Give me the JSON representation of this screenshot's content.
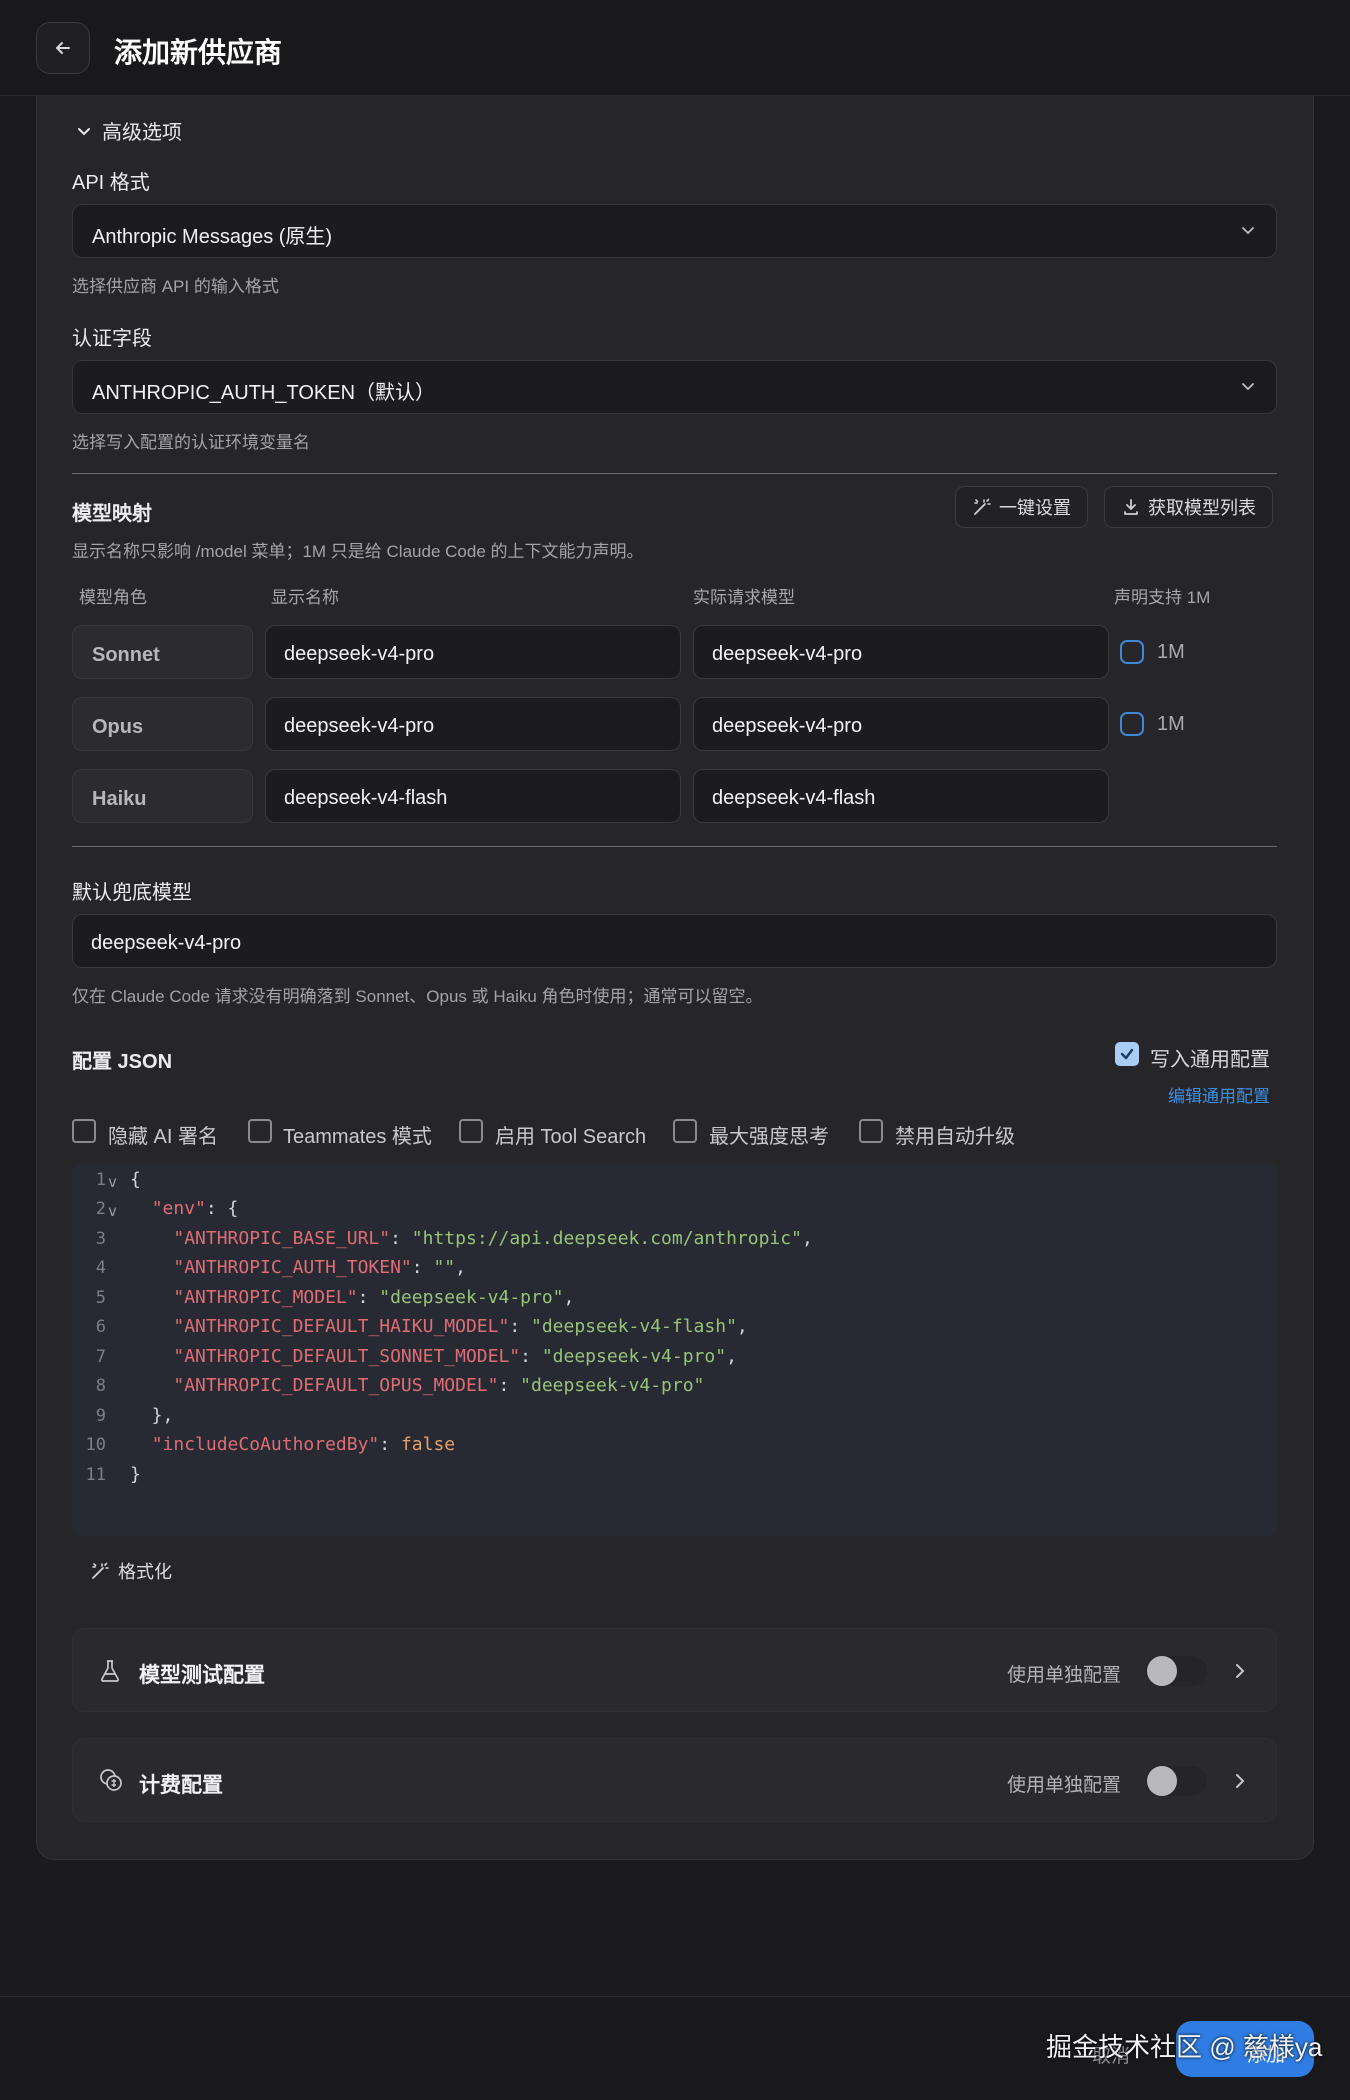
{
  "header": {
    "title": "添加新供应商"
  },
  "advanced": {
    "toggle_label": "高级选项"
  },
  "api_format": {
    "label": "API 格式",
    "value": "Anthropic Messages (原生)",
    "hint": "选择供应商 API 的输入格式"
  },
  "auth_field": {
    "label": "认证字段",
    "value": "ANTHROPIC_AUTH_TOKEN（默认）",
    "hint": "选择写入配置的认证环境变量名"
  },
  "model_mapping": {
    "title": "模型映射",
    "one_click_label": "一键设置",
    "fetch_label": "获取模型列表",
    "hint": "显示名称只影响 /model 菜单；1M 只是给 Claude Code 的上下文能力声明。",
    "columns": {
      "role": "模型角色",
      "display": "显示名称",
      "actual": "实际请求模型",
      "support": "声明支持 1M"
    },
    "rows": [
      {
        "role": "Sonnet",
        "display": "deepseek-v4-pro",
        "actual": "deepseek-v4-pro",
        "check_label": "1M"
      },
      {
        "role": "Opus",
        "display": "deepseek-v4-pro",
        "actual": "deepseek-v4-pro",
        "check_label": "1M"
      },
      {
        "role": "Haiku",
        "display": "deepseek-v4-flash",
        "actual": "deepseek-v4-flash"
      }
    ]
  },
  "fallback": {
    "label": "默认兜底模型",
    "value": "deepseek-v4-pro",
    "hint": "仅在 Claude Code 请求没有明确落到 Sonnet、Opus 或 Haiku 角色时使用；通常可以留空。"
  },
  "config_json": {
    "title": "配置 JSON",
    "write_common_label": "写入通用配置",
    "edit_common_label": "编辑通用配置",
    "options": [
      "隐藏 AI 署名",
      "Teammates 模式",
      "启用 Tool Search",
      "最大强度思考",
      "禁用自动升级"
    ],
    "line_numbers": [
      "1",
      "2",
      "3",
      "4",
      "5",
      "6",
      "7",
      "8",
      "9",
      "10",
      "11"
    ],
    "format_label": "格式化"
  },
  "model_test": {
    "title": "模型测试配置",
    "right_label": "使用单独配置"
  },
  "billing": {
    "title": "计费配置",
    "right_label": "使用单独配置"
  },
  "footer": {
    "hidden_left": "取消",
    "submit_label": "添加",
    "watermark": "掘金技术社区 @ 慈様ya"
  },
  "colors": {
    "accent": "#2f7de3",
    "link": "#3b8ee8",
    "key": "#e06c75",
    "string": "#98c379",
    "bool": "#e5a16a"
  }
}
